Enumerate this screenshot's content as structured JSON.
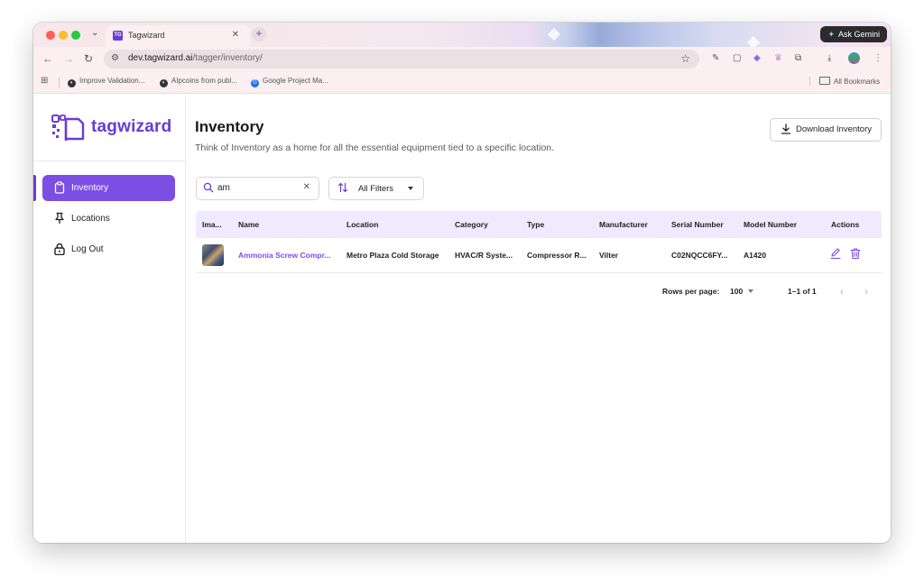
{
  "browser": {
    "tab_title": "Tagwizard",
    "tab_favicon_text": "TG",
    "ask_gemini_label": "Ask Gemini",
    "url_host": "dev.tagwizard.ai",
    "url_path": "/tagger/inventory/",
    "bookmarks": [
      {
        "label": "Improve Validation...",
        "icon": "globe-icon"
      },
      {
        "label": "AIpcoins from publ...",
        "icon": "globe-icon"
      },
      {
        "label": "Google Project Ma...",
        "icon": "google-icon"
      }
    ],
    "all_bookmarks_label": "All Bookmarks"
  },
  "sidebar": {
    "brand": "tagwizard",
    "items": [
      {
        "label": "Inventory",
        "icon": "clipboard-icon",
        "active": true
      },
      {
        "label": "Locations",
        "icon": "pin-icon",
        "active": false
      },
      {
        "label": "Log Out",
        "icon": "lock-icon",
        "active": false
      }
    ]
  },
  "main": {
    "title": "Inventory",
    "subtitle": "Think of Inventory as a home for all the essential equipment tied to a specific location.",
    "download_label": "Download Inventory",
    "search_value": "am",
    "filters_label": "All Filters"
  },
  "table": {
    "columns": [
      "Ima...",
      "Name",
      "Location",
      "Category",
      "Type",
      "Manufacturer",
      "Serial Number",
      "Model Number",
      "Actions"
    ],
    "rows": [
      {
        "name": "Ammonia Screw Compr...",
        "location": "Metro Plaza Cold Storage",
        "category": "HVAC/R Syste...",
        "type": "Compressor R...",
        "manufacturer": "Vilter",
        "serial": "C02NQCC6FY...",
        "model": "A1420"
      }
    ]
  },
  "pagination": {
    "rows_per_page_label": "Rows per page:",
    "rows_per_page_value": "100",
    "range_label": "1–1 of 1"
  },
  "colors": {
    "brand": "#6b3bd6",
    "active_nav": "#7c4ee4",
    "table_header_bg": "#efeafd"
  }
}
